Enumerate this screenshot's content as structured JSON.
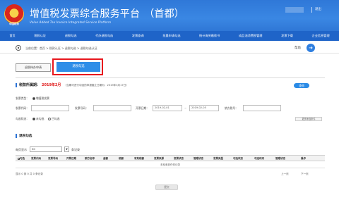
{
  "header": {
    "title": "增值税发票综合服务平台",
    "region": "（首都）",
    "subtitle": "Value Added Tax Invoice Integrated Service Platform",
    "emblem_caption": "中国税务",
    "logout": "退出"
  },
  "nav": {
    "items": [
      "首页",
      "税款认证",
      "退税勾选",
      "代办退税勾选",
      "发票查询",
      "批量申请勾选",
      "统计海关缴款书",
      "成品油消费税管理",
      "发票下载",
      "企业信息管理"
    ]
  },
  "breadcrumb": {
    "text": "当前位置：首页 > 税款认证 > 退税勾选 > 退税勾选认证",
    "help_label": "帮助"
  },
  "tabs": {
    "unpaid_apply": "退税待办申请",
    "deduct_select": "退税勾选"
  },
  "period": {
    "label": "税款所属期：",
    "value": "2019年2月",
    "note": "（当期可进行勾选的申报截止日期为：2019年3月17日）",
    "query_button": "查询"
  },
  "form": {
    "invoice_type_label": "发票类型：",
    "invoice_type_option": "增值税发票",
    "invoice_code_label": "发票代码：",
    "invoice_number_label": "发票号码：",
    "issue_date_label": "开票日期：",
    "date_from": "2019-02-01",
    "date_to": "2019-02-05",
    "date_sep": "~",
    "seller_tax_label": "销方税号：",
    "select_status_label": "勾选状态：",
    "status_unselected": "未勾选",
    "status_selected": "已勾选",
    "more_button": "更多筛选条件"
  },
  "results": {
    "section_title": "退税勾选",
    "page_size_label": "每页显示",
    "page_size_value": "50",
    "records_label": "条记录",
    "columns": [
      "勾选",
      "发票代码",
      "发票号码",
      "开票日期",
      "销方名称",
      "金额",
      "税额",
      "有效税额",
      "发票来源",
      "发票状态",
      "管理状态",
      "发票类型",
      "勾选状态",
      "勾选时间",
      "管理状态",
      "操作"
    ],
    "no_data": "未检索到任何记录",
    "summary": "显示 0 到 0 共 0 条记录",
    "prev": "上一页",
    "next": "下一页",
    "submit_button": "提交"
  },
  "colors": {
    "header_blue": "#2f78d8",
    "nav_blue": "#1f64c8",
    "accent_red": "#e8161d",
    "button_blue": "#2b8be6"
  }
}
